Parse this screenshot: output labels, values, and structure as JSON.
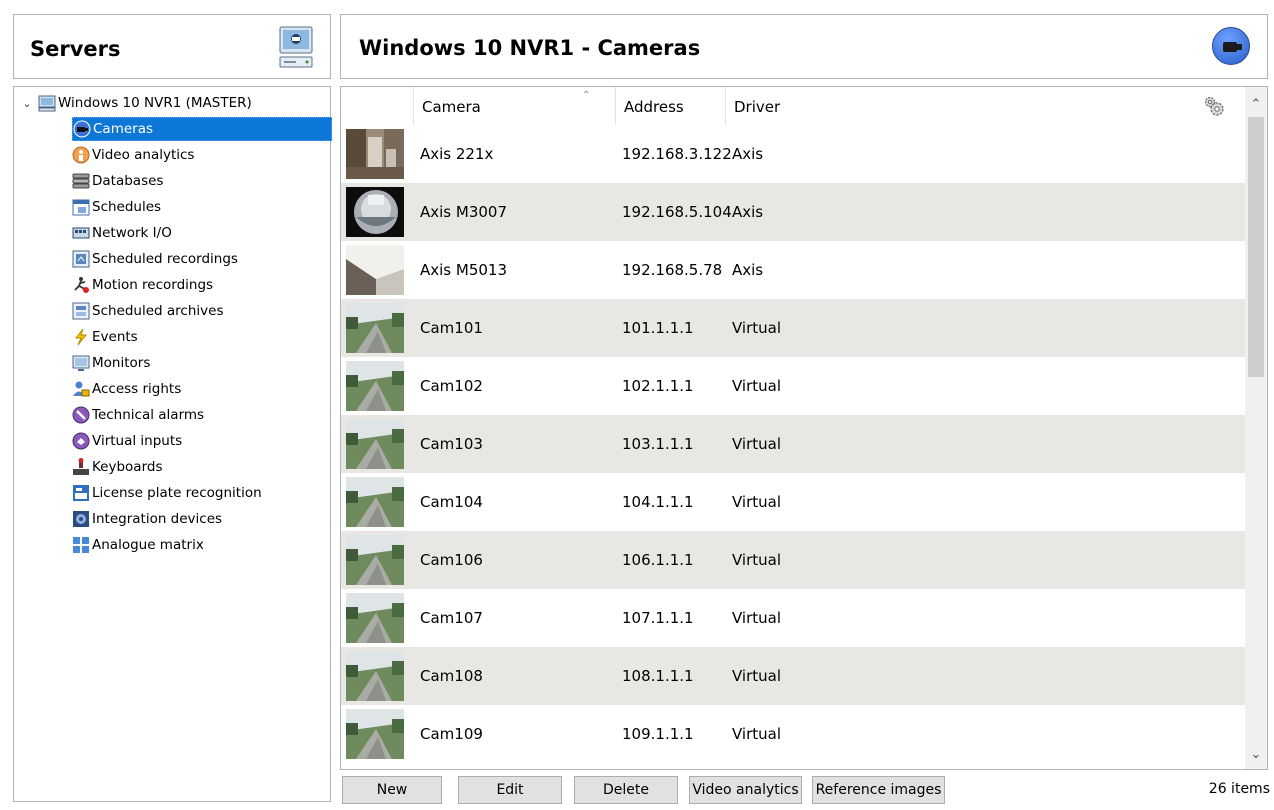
{
  "left_panel": {
    "title": "Servers",
    "tree_root": "Windows 10 NVR1 (MASTER)",
    "items": [
      {
        "label": "Cameras",
        "icon": "camera-icon"
      },
      {
        "label": "Video analytics",
        "icon": "video-analytics-icon"
      },
      {
        "label": "Databases",
        "icon": "database-icon"
      },
      {
        "label": "Schedules",
        "icon": "schedule-icon"
      },
      {
        "label": "Network I/O",
        "icon": "network-io-icon"
      },
      {
        "label": "Scheduled recordings",
        "icon": "scheduled-recordings-icon"
      },
      {
        "label": "Motion recordings",
        "icon": "motion-recordings-icon"
      },
      {
        "label": "Scheduled archives",
        "icon": "scheduled-archives-icon"
      },
      {
        "label": "Events",
        "icon": "events-icon"
      },
      {
        "label": "Monitors",
        "icon": "monitor-icon"
      },
      {
        "label": "Access rights",
        "icon": "access-rights-icon"
      },
      {
        "label": "Technical alarms",
        "icon": "technical-alarms-icon"
      },
      {
        "label": "Virtual inputs",
        "icon": "virtual-inputs-icon"
      },
      {
        "label": "Keyboards",
        "icon": "keyboard-icon"
      },
      {
        "label": "License plate recognition",
        "icon": "license-plate-icon"
      },
      {
        "label": "Integration devices",
        "icon": "integration-devices-icon"
      },
      {
        "label": "Analogue matrix",
        "icon": "analogue-matrix-icon"
      }
    ]
  },
  "right_panel": {
    "title": "Windows 10 NVR1 - Cameras",
    "columns": {
      "camera": "Camera",
      "address": "Address",
      "driver": "Driver"
    },
    "rows": [
      {
        "camera": "Axis 221x",
        "address": "192.168.3.122",
        "driver": "Axis",
        "thumb": "room"
      },
      {
        "camera": "Axis M3007",
        "address": "192.168.5.104",
        "driver": "Axis",
        "thumb": "fisheye"
      },
      {
        "camera": "Axis M5013",
        "address": "192.168.5.78",
        "driver": "Axis",
        "thumb": "wall"
      },
      {
        "camera": "Cam101",
        "address": "101.1.1.1",
        "driver": "Virtual",
        "thumb": "yard"
      },
      {
        "camera": "Cam102",
        "address": "102.1.1.1",
        "driver": "Virtual",
        "thumb": "yard"
      },
      {
        "camera": "Cam103",
        "address": "103.1.1.1",
        "driver": "Virtual",
        "thumb": "yard"
      },
      {
        "camera": "Cam104",
        "address": "104.1.1.1",
        "driver": "Virtual",
        "thumb": "yard"
      },
      {
        "camera": "Cam106",
        "address": "106.1.1.1",
        "driver": "Virtual",
        "thumb": "yard"
      },
      {
        "camera": "Cam107",
        "address": "107.1.1.1",
        "driver": "Virtual",
        "thumb": "yard"
      },
      {
        "camera": "Cam108",
        "address": "108.1.1.1",
        "driver": "Virtual",
        "thumb": "yard"
      },
      {
        "camera": "Cam109",
        "address": "109.1.1.1",
        "driver": "Virtual",
        "thumb": "yard"
      }
    ],
    "buttons": {
      "new": "New",
      "edit": "Edit",
      "delete": "Delete",
      "video_analytics": "Video analytics",
      "reference_images": "Reference images"
    },
    "item_count": "26 items"
  }
}
